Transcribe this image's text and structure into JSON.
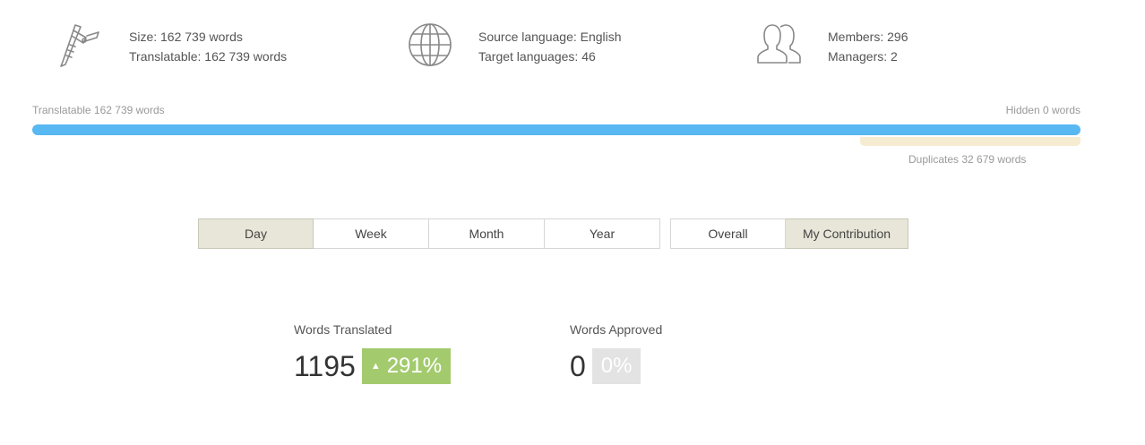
{
  "summary": {
    "size": {
      "icon": "caliper-icon",
      "line1": "Size: 162 739 words",
      "line2": "Translatable: 162 739 words"
    },
    "languages": {
      "icon": "globe-icon",
      "line1": "Source language: English",
      "line2": "Target languages: 46"
    },
    "members": {
      "icon": "users-icon",
      "line1": "Members: 296",
      "line2": "Managers: 2"
    }
  },
  "word_bar": {
    "translatable_label": "Translatable 162 739 words",
    "hidden_label": "Hidden 0 words",
    "duplicates_label": "Duplicates 32 679 words",
    "translatable_fraction": 1.0,
    "duplicates_fraction": 0.2,
    "bar_color": "#58b8f2",
    "duplicates_color": "#f6ecd2"
  },
  "period_tabs": [
    {
      "label": "Day",
      "active": true
    },
    {
      "label": "Week",
      "active": false
    },
    {
      "label": "Month",
      "active": false
    },
    {
      "label": "Year",
      "active": false
    }
  ],
  "scope_tabs": [
    {
      "label": "Overall",
      "active": false
    },
    {
      "label": "My Contribution",
      "active": true
    }
  ],
  "stats": {
    "translated": {
      "label": "Words Translated",
      "value": "1195",
      "change": "291%",
      "trend_icon": "arrow-up-icon",
      "badge_color": "#a3cb6e"
    },
    "approved": {
      "label": "Words Approved",
      "value": "0",
      "change": "0%",
      "badge_color": "#e3e3e3"
    }
  }
}
